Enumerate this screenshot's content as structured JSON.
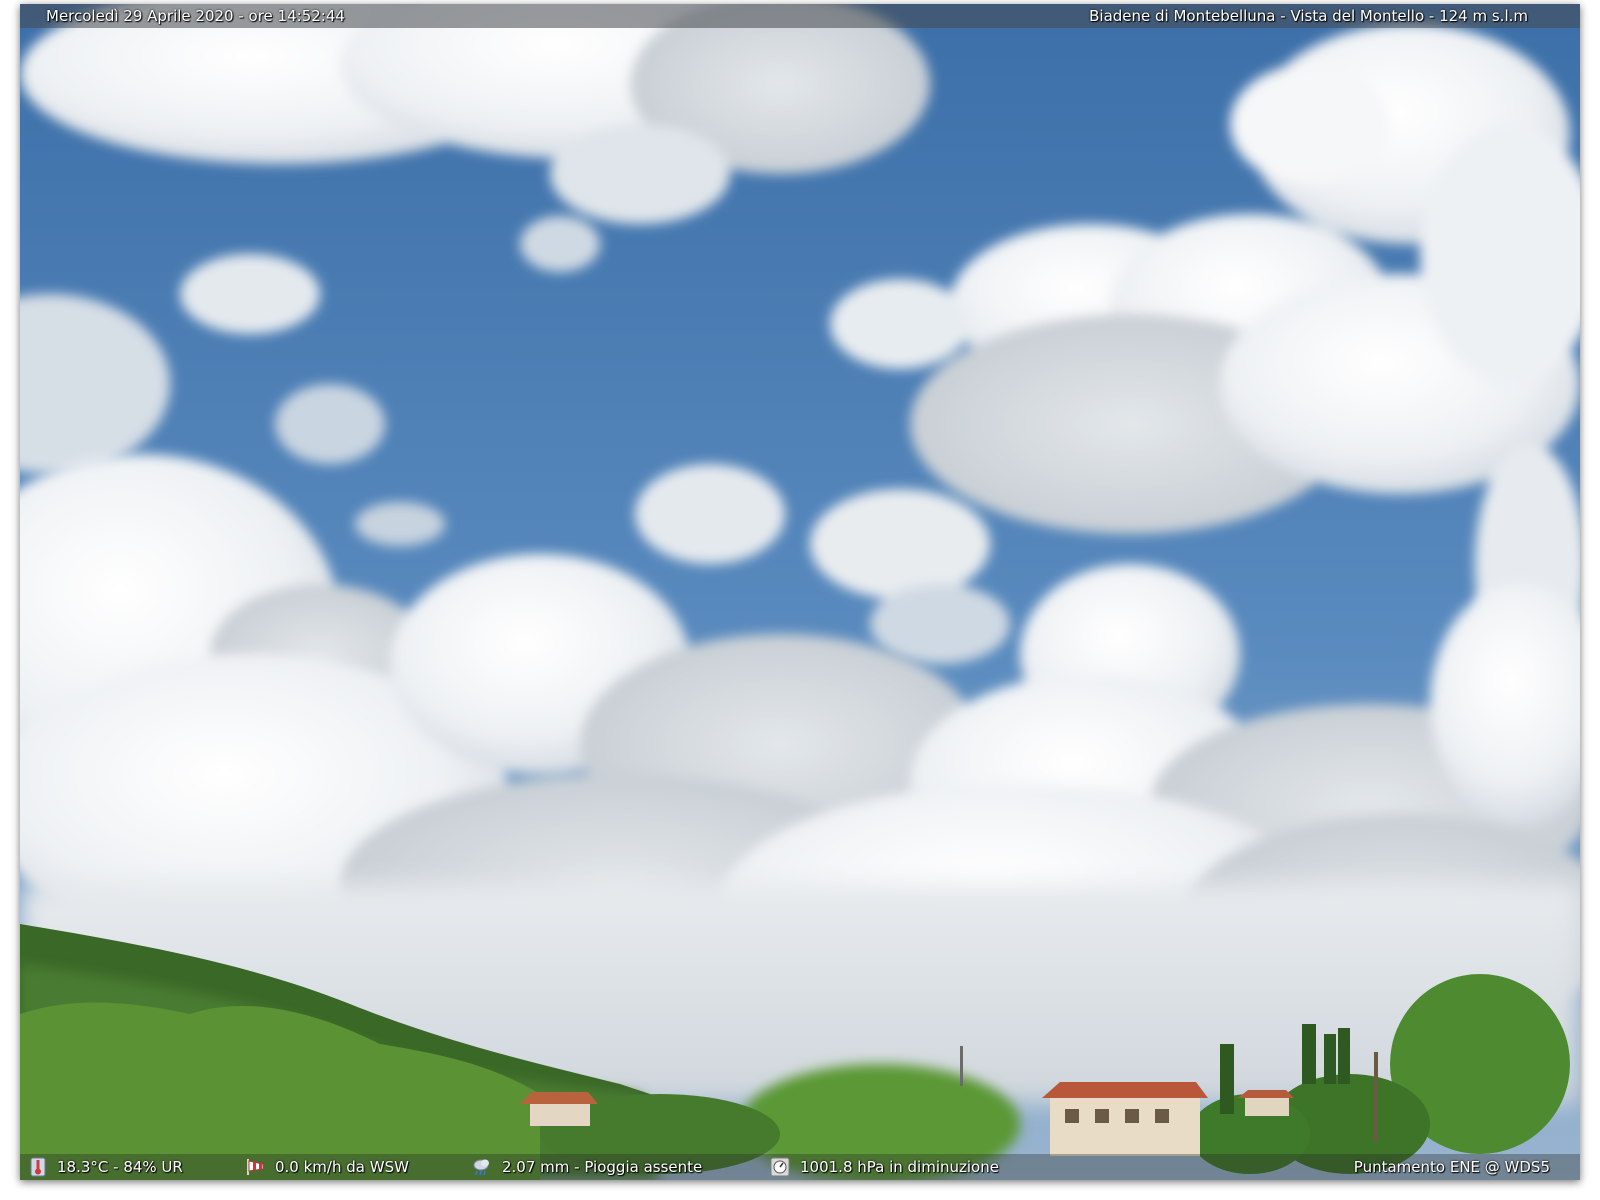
{
  "header": {
    "datetime": "Mercoledì 29 Aprile 2020 - ore 14:52:44",
    "location": "Biadene di Montebelluna - Vista del Montello - 124 m s.l.m"
  },
  "footer": {
    "temperature_humidity": "18.3°C - 84% UR",
    "wind": "0.0 km/h da WSW",
    "rain": "2.07 mm - Pioggia assente",
    "pressure": "1001.8 hPa in diminuzione",
    "orientation": "Puntamento ENE  @ WDS5"
  },
  "icons": {
    "temperature": "thermometer-icon",
    "wind": "windsock-icon",
    "rain": "rain-cloud-icon",
    "pressure": "barometer-icon"
  },
  "colors": {
    "sky_top": "#3f74ad",
    "sky_bottom": "#7ea3c9",
    "cloud": "#f4f6f8",
    "hill": "#3f6d2a",
    "trees": "#4f8a2f"
  }
}
